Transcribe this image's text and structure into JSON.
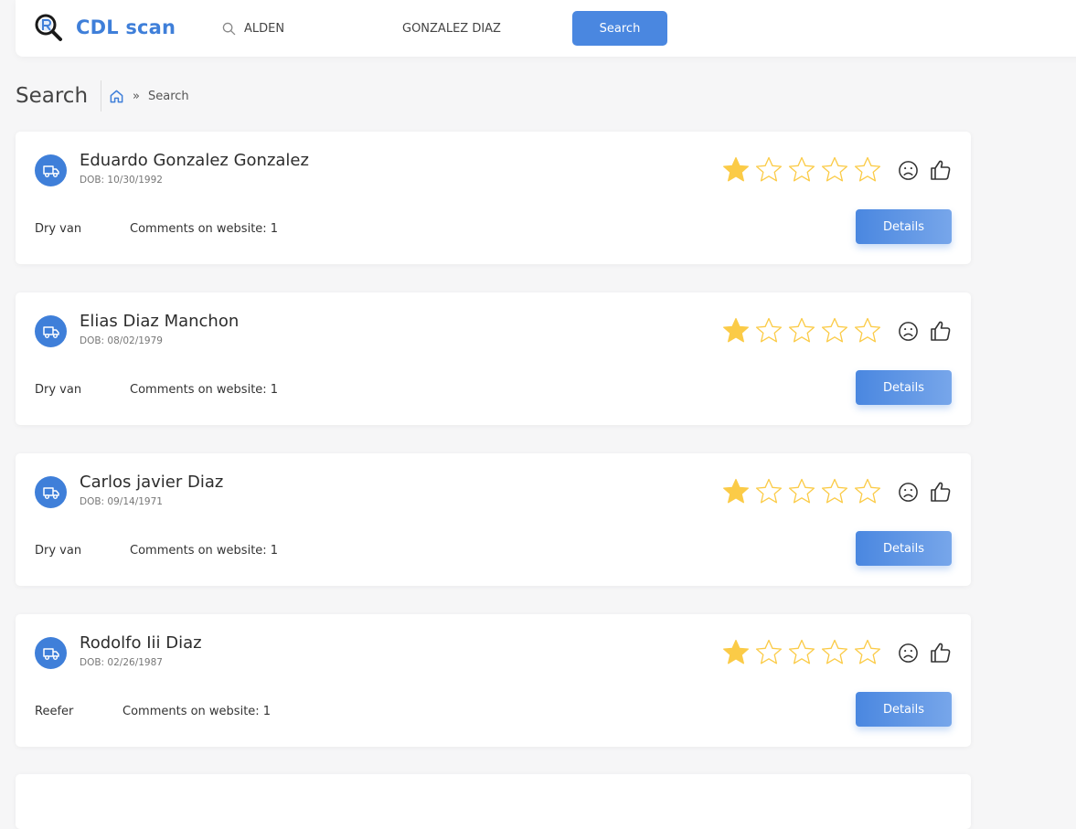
{
  "app": {
    "name": "CDL scan"
  },
  "search": {
    "first_name_value": "ALDEN",
    "last_name_value": "GONZALEZ DIAZ",
    "button_label": "Search"
  },
  "page": {
    "title": "Search",
    "breadcrumb_current": "Search",
    "breadcrumb_separator": "»"
  },
  "colors": {
    "accent": "#3f7fd9",
    "star": "#fbcb47",
    "background": "#f6f6f7"
  },
  "results": [
    {
      "name": "Eduardo Gonzalez Gonzalez",
      "dob": "DOB: 10/30/1992",
      "trailer": "Dry van",
      "comments": "Comments on website: 1",
      "rating": 1,
      "rating_max": 5,
      "details_label": "Details"
    },
    {
      "name": "Elias Diaz Manchon",
      "dob": "DOB: 08/02/1979",
      "trailer": "Dry van",
      "comments": "Comments on website: 1",
      "rating": 1,
      "rating_max": 5,
      "details_label": "Details"
    },
    {
      "name": "Carlos javier Diaz",
      "dob": "DOB: 09/14/1971",
      "trailer": "Dry van",
      "comments": "Comments on website: 1",
      "rating": 1,
      "rating_max": 5,
      "details_label": "Details"
    },
    {
      "name": "Rodolfo Iii Diaz",
      "dob": "DOB: 02/26/1987",
      "trailer": "Reefer",
      "comments": "Comments on website: 1",
      "rating": 1,
      "rating_max": 5,
      "details_label": "Details"
    }
  ],
  "icons": {
    "logo": "magnifier-logo-icon",
    "search": "search-icon",
    "home": "home-icon",
    "truck": "truck-icon",
    "star": "star-icon",
    "frown": "frown-icon",
    "thumb": "thumbs-up-icon"
  }
}
